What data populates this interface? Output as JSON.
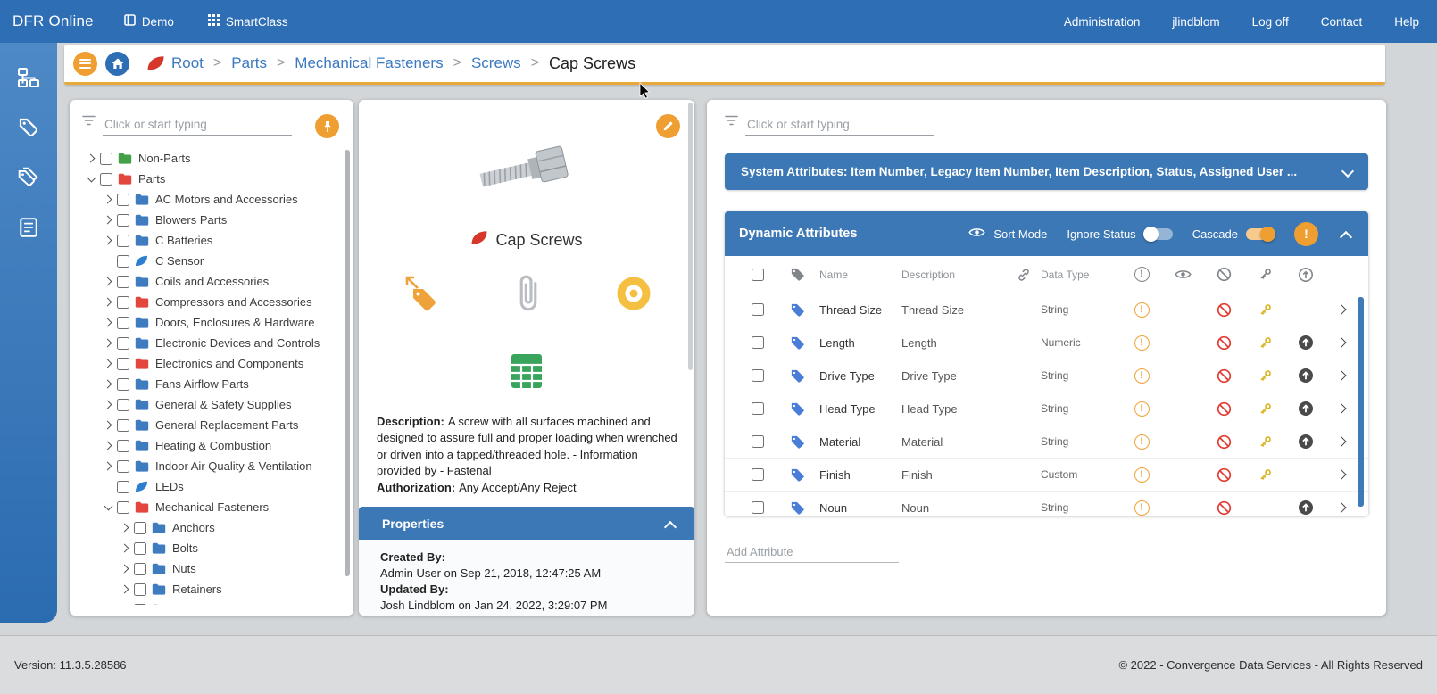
{
  "colors": {
    "topbar_blue": "#2e6eb5",
    "panel_header_blue": "#3c78b5",
    "accent_orange": "#ef9f31",
    "link_blue": "#3b79c0",
    "tag_blue": "#4a7dd8",
    "warn_orange": "#f0a23a",
    "block_red": "#e23b32",
    "key_gold": "#d9b422",
    "up_dark": "#4a4a4a",
    "folder_green": "#43a047",
    "folder_red": "#e2463c",
    "folder_blue": "#3e7cbf",
    "leaf_red": "#d7372b",
    "leaf_blue": "#2e7ecf",
    "icon_gray": "#80868c"
  },
  "top_nav": {
    "brand": "DFR Online",
    "demo": "Demo",
    "smartclass": "SmartClass",
    "right": [
      "Administration",
      "jlindblom",
      "Log off",
      "Contact",
      "Help"
    ]
  },
  "breadcrumb": {
    "links": [
      "Root",
      "Parts",
      "Mechanical Fasteners",
      "Screws"
    ],
    "current": "Cap Screws",
    "separator": ">"
  },
  "tree": {
    "search_placeholder": "Click or start typing",
    "items": [
      {
        "level": 0,
        "expander": "right",
        "icon": "folder-green",
        "label": "Non-Parts"
      },
      {
        "level": 0,
        "expander": "down",
        "icon": "folder-red",
        "label": "Parts"
      },
      {
        "level": 1,
        "expander": "right",
        "icon": "folder-blue",
        "label": "AC Motors and Accessories"
      },
      {
        "level": 1,
        "expander": "right",
        "icon": "folder-blue",
        "label": "Blowers Parts"
      },
      {
        "level": 1,
        "expander": "right",
        "icon": "folder-blue",
        "label": "C Batteries"
      },
      {
        "level": 1,
        "expander": "none",
        "icon": "leaf-blue",
        "label": "C Sensor"
      },
      {
        "level": 1,
        "expander": "right",
        "icon": "folder-blue",
        "label": "Coils and Accessories"
      },
      {
        "level": 1,
        "expander": "right",
        "icon": "folder-red",
        "label": "Compressors and Accessories"
      },
      {
        "level": 1,
        "expander": "right",
        "icon": "folder-blue",
        "label": "Doors, Enclosures & Hardware"
      },
      {
        "level": 1,
        "expander": "right",
        "icon": "folder-blue",
        "label": "Electronic Devices and Controls"
      },
      {
        "level": 1,
        "expander": "right",
        "icon": "folder-red",
        "label": "Electronics and Components"
      },
      {
        "level": 1,
        "expander": "right",
        "icon": "folder-blue",
        "label": "Fans Airflow Parts"
      },
      {
        "level": 1,
        "expander": "right",
        "icon": "folder-blue",
        "label": "General & Safety Supplies"
      },
      {
        "level": 1,
        "expander": "right",
        "icon": "folder-blue",
        "label": "General Replacement Parts"
      },
      {
        "level": 1,
        "expander": "right",
        "icon": "folder-blue",
        "label": "Heating & Combustion"
      },
      {
        "level": 1,
        "expander": "right",
        "icon": "folder-blue",
        "label": "Indoor Air Quality & Ventilation"
      },
      {
        "level": 1,
        "expander": "none",
        "icon": "leaf-blue",
        "label": "LEDs"
      },
      {
        "level": 1,
        "expander": "down",
        "icon": "folder-red",
        "label": "Mechanical Fasteners"
      },
      {
        "level": 2,
        "expander": "right",
        "icon": "folder-blue",
        "label": "Anchors"
      },
      {
        "level": 2,
        "expander": "right",
        "icon": "folder-blue",
        "label": "Bolts"
      },
      {
        "level": 2,
        "expander": "right",
        "icon": "folder-blue",
        "label": "Nuts"
      },
      {
        "level": 2,
        "expander": "right",
        "icon": "folder-blue",
        "label": "Retainers"
      },
      {
        "level": 2,
        "expander": "right",
        "icon": "folder-blue",
        "label": "Screws"
      }
    ]
  },
  "detail": {
    "title": "Cap Screws",
    "description_label": "Description:",
    "description": "A screw with all surfaces machined and designed to assure full and proper loading when wrenched or driven into a tapped/threaded hole. - Information provided by - Fastenal",
    "authorization_label": "Authorization:",
    "authorization": "Any Accept/Any Reject",
    "properties": {
      "header": "Properties",
      "created_by_label": "Created By:",
      "created_by": "Admin User on Sep 21, 2018, 12:47:25 AM",
      "updated_by_label": "Updated By:",
      "updated_by": "Josh Lindblom on Jan 24, 2022, 3:29:07 PM"
    }
  },
  "attributes": {
    "search_placeholder": "Click or start typing",
    "system_bar": "System Attributes: Item Number, Legacy Item Number, Item Description, Status, Assigned User ...",
    "dynamic": {
      "title": "Dynamic Attributes",
      "sort_mode": "Sort Mode",
      "ignore_status": "Ignore Status",
      "ignore_status_on": false,
      "cascade": "Cascade",
      "cascade_on": true,
      "alert_label": "!",
      "columns": {
        "name": "Name",
        "description": "Description",
        "data_type": "Data Type"
      },
      "rows": [
        {
          "name": "Thread Size",
          "description": "Thread Size",
          "data_type": "String",
          "key": true,
          "up": false
        },
        {
          "name": "Length",
          "description": "Length",
          "data_type": "Numeric",
          "key": true,
          "up": true
        },
        {
          "name": "Drive Type",
          "description": "Drive Type",
          "data_type": "String",
          "key": true,
          "up": true
        },
        {
          "name": "Head Type",
          "description": "Head Type",
          "data_type": "String",
          "key": true,
          "up": true
        },
        {
          "name": "Material",
          "description": "Material",
          "data_type": "String",
          "key": true,
          "up": true
        },
        {
          "name": "Finish",
          "description": "Finish",
          "data_type": "Custom",
          "key": true,
          "up": false
        },
        {
          "name": "Noun",
          "description": "Noun",
          "data_type": "String",
          "key": false,
          "up": true
        }
      ],
      "add_placeholder": "Add Attribute"
    }
  },
  "footer": {
    "version": "Version: 11.3.5.28586",
    "copyright": "© 2022 - Convergence Data Services - All Rights Reserved"
  }
}
